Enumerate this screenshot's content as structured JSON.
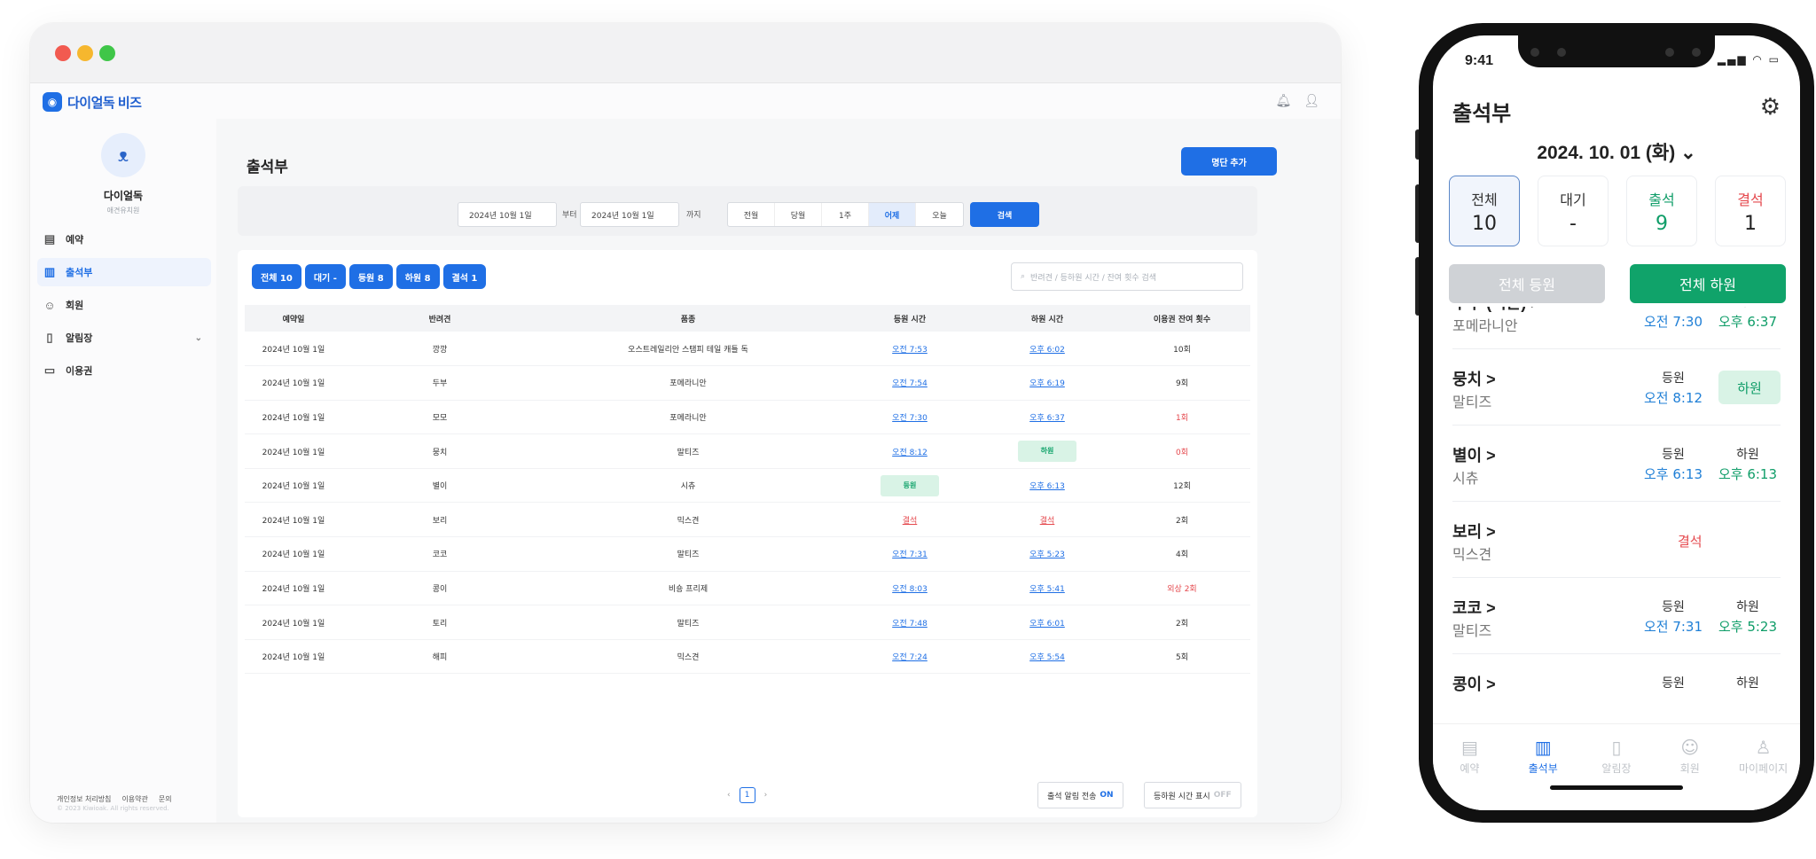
{
  "desktop": {
    "brand": "다이얼독 비즈",
    "profile": {
      "name": "다이얼독",
      "sub": "애견유치원"
    },
    "nav": [
      {
        "label": "예약",
        "icon": "calendar-icon"
      },
      {
        "label": "출석부",
        "icon": "clipboard-icon"
      },
      {
        "label": "회원",
        "icon": "users-icon"
      },
      {
        "label": "알림장",
        "icon": "notebook-icon"
      },
      {
        "label": "이용권",
        "icon": "ticket-icon"
      }
    ],
    "footer": {
      "privacy": "개인정보 처리방침",
      "terms": "이용약관",
      "contact": "문의",
      "copyright": "© 2023 Kiwioak. All rights reserved."
    },
    "page_title": "출석부",
    "add_button": "명단 추가",
    "filter": {
      "from_date": "2024년 10월 1일",
      "from_label": "부터",
      "to_date": "2024년 10월 1일",
      "to_label": "까지",
      "ranges": [
        "전월",
        "당월",
        "1주",
        "어제",
        "오늘"
      ],
      "active_range": "어제",
      "search": "검색"
    },
    "chips": [
      "전체 10",
      "대기 -",
      "등원 8",
      "하원 8",
      "결석 1"
    ],
    "search_placeholder": "반려견 / 등하원 시간 / 잔여 횟수 검색",
    "columns": [
      "예약일",
      "반려견",
      "품종",
      "등원 시간",
      "하원 시간",
      "이용권 잔여 횟수"
    ],
    "rows": [
      {
        "date": "2024년 10월 1일",
        "dog": "깡깡",
        "breed": "오스트레일리안 스탬피 테일 캐틀 독",
        "in": "오전 7:53",
        "out": "오후 6:02",
        "remain": "10회"
      },
      {
        "date": "2024년 10월 1일",
        "dog": "두부",
        "breed": "포메라니안",
        "in": "오전 7:54",
        "out": "오후 6:19",
        "remain": "9회"
      },
      {
        "date": "2024년 10월 1일",
        "dog": "모모",
        "breed": "포메라니안",
        "in": "오전 7:30",
        "out": "오후 6:37",
        "remain": "1회"
      },
      {
        "date": "2024년 10월 1일",
        "dog": "뭉치",
        "breed": "말티즈",
        "in": "오전 8:12",
        "out": "하원",
        "remain": "0회"
      },
      {
        "date": "2024년 10월 1일",
        "dog": "별이",
        "breed": "시츄",
        "in": "등원",
        "out": "오후 6:13",
        "remain": "12회"
      },
      {
        "date": "2024년 10월 1일",
        "dog": "보리",
        "breed": "믹스견",
        "in": "결석",
        "out": "결석",
        "remain": "2회"
      },
      {
        "date": "2024년 10월 1일",
        "dog": "코코",
        "breed": "말티즈",
        "in": "오전 7:31",
        "out": "오후 5:23",
        "remain": "4회"
      },
      {
        "date": "2024년 10월 1일",
        "dog": "콩이",
        "breed": "비숑 프리제",
        "in": "오전 8:03",
        "out": "오후 5:41",
        "remain": "외상 2회"
      },
      {
        "date": "2024년 10월 1일",
        "dog": "토리",
        "breed": "말티즈",
        "in": "오전 7:48",
        "out": "오후 6:01",
        "remain": "2회"
      },
      {
        "date": "2024년 10월 1일",
        "dog": "해피",
        "breed": "믹스견",
        "in": "오전 7:24",
        "out": "오후 5:54",
        "remain": "5회"
      }
    ],
    "page": "1",
    "toggle_alert": {
      "label": "출석 알림 전송",
      "state": "ON"
    },
    "toggle_time": {
      "label": "등하원 시간 표시",
      "state": "OFF"
    }
  },
  "phone": {
    "time": "9:41",
    "title": "출석부",
    "date": "2024. 10. 01 (화)",
    "stats": [
      {
        "label": "전체",
        "value": "10"
      },
      {
        "label": "대기",
        "value": "-"
      },
      {
        "label": "출석",
        "value": "9"
      },
      {
        "label": "결석",
        "value": "1"
      }
    ],
    "btn_in": "전체 등원",
    "btn_out": "전체 하원",
    "in_label": "등원",
    "out_label": "하원",
    "rows": [
      {
        "name": "두부 (익은) >",
        "breed": "포메라니안",
        "in": "오전 7:30",
        "out": "오후 6:37"
      },
      {
        "name": "뭉치 >",
        "breed": "말티즈",
        "in": "오전 8:12",
        "out_btn": "하원"
      },
      {
        "name": "별이 >",
        "breed": "시츄",
        "in": "오후 6:13",
        "out": "오후 6:13"
      },
      {
        "name": "보리 >",
        "breed": "믹스견",
        "absent": "결석"
      },
      {
        "name": "코코 >",
        "breed": "말티즈",
        "in": "오전 7:31",
        "out": "오후 5:23"
      },
      {
        "name": "콩이 >",
        "breed": "",
        "in": "",
        "out": ""
      }
    ],
    "tabs": [
      {
        "label": "예약",
        "icon": "calendar-icon"
      },
      {
        "label": "출석부",
        "icon": "clipboard-icon"
      },
      {
        "label": "알림장",
        "icon": "notebook-icon"
      },
      {
        "label": "회원",
        "icon": "users-icon"
      },
      {
        "label": "마이페이지",
        "icon": "person-icon"
      }
    ],
    "active_tab": "출석부"
  }
}
